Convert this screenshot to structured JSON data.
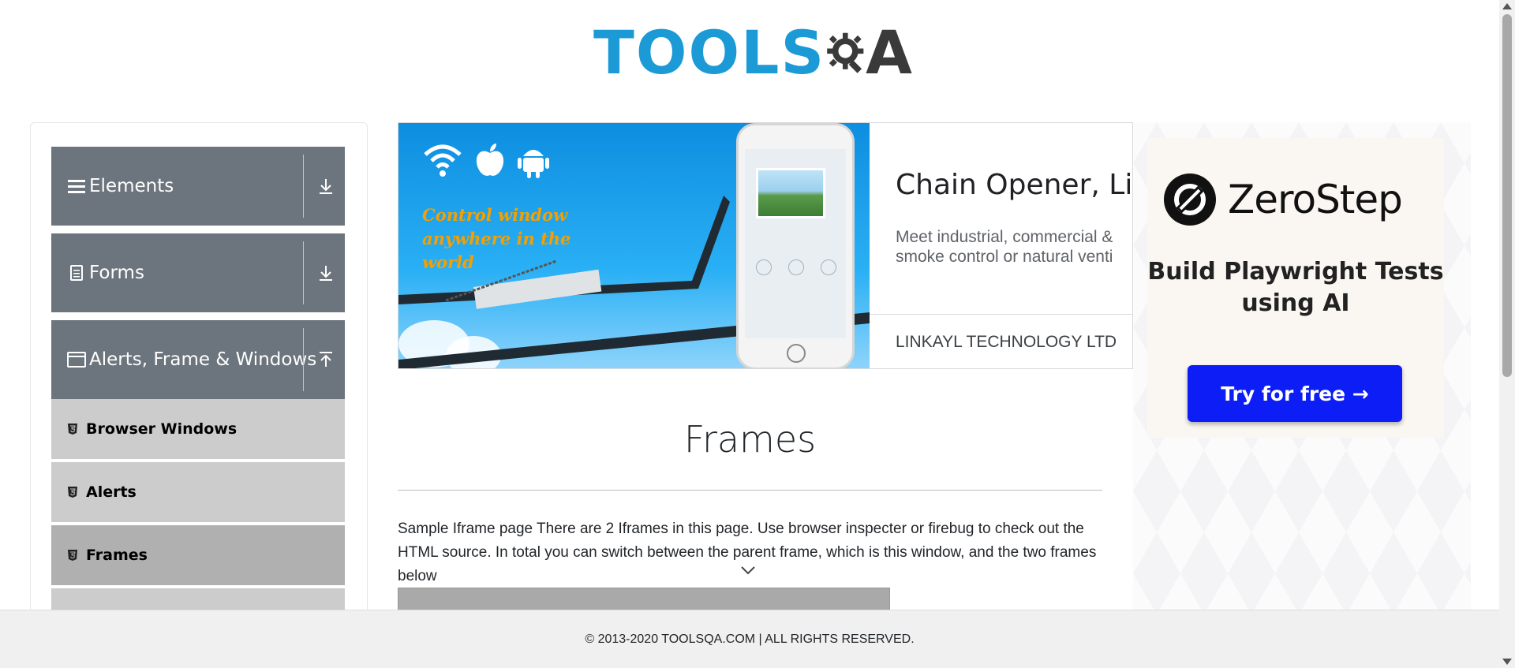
{
  "logo": {
    "text_tools": "TOOLS",
    "text_a": "A"
  },
  "sidebar": {
    "groups": [
      {
        "label": "Elements",
        "icon": "hamburger-icon",
        "arrow": "download-arrow-icon"
      },
      {
        "label": "Forms",
        "icon": "document-icon",
        "arrow": "download-arrow-icon"
      },
      {
        "label": "Alerts, Frame & Windows",
        "icon": "window-icon",
        "arrow": "upload-arrow-icon"
      }
    ],
    "items": [
      {
        "label": "Browser Windows",
        "icon": "html5-icon"
      },
      {
        "label": "Alerts",
        "icon": "html5-icon"
      },
      {
        "label": "Frames",
        "icon": "html5-icon",
        "active": true
      }
    ]
  },
  "ad_banner": {
    "tagline": "Control window anywhere in the world",
    "title": "Chain Opener, Lin",
    "description_line1": "Meet industrial, commercial &",
    "description_line2": "smoke control or natural venti",
    "company": "LINKAYL TECHNOLOGY LTD",
    "image_icons": [
      "wifi-icon",
      "apple-icon",
      "android-icon"
    ]
  },
  "main": {
    "title": "Frames",
    "description": "Sample Iframe page There are 2 Iframes in this page. Use browser inspecter or firebug to check out the HTML source. In total you can switch between the parent frame, which is this window, and the two frames below"
  },
  "right_ad": {
    "brand": "ZeroStep",
    "tagline": "Build Playwright Tests using AI",
    "button_label": "Try for free →",
    "button_color": "#0c1ef5"
  },
  "footer": {
    "text": "© 2013-2020 TOOLSQA.COM | ALL RIGHTS RESERVED."
  },
  "colors": {
    "brand_blue": "#1b9ad6",
    "sidebar_header": "#6c757d",
    "sidebar_item": "#cccccc",
    "sidebar_item_active": "#b0b0b0"
  }
}
